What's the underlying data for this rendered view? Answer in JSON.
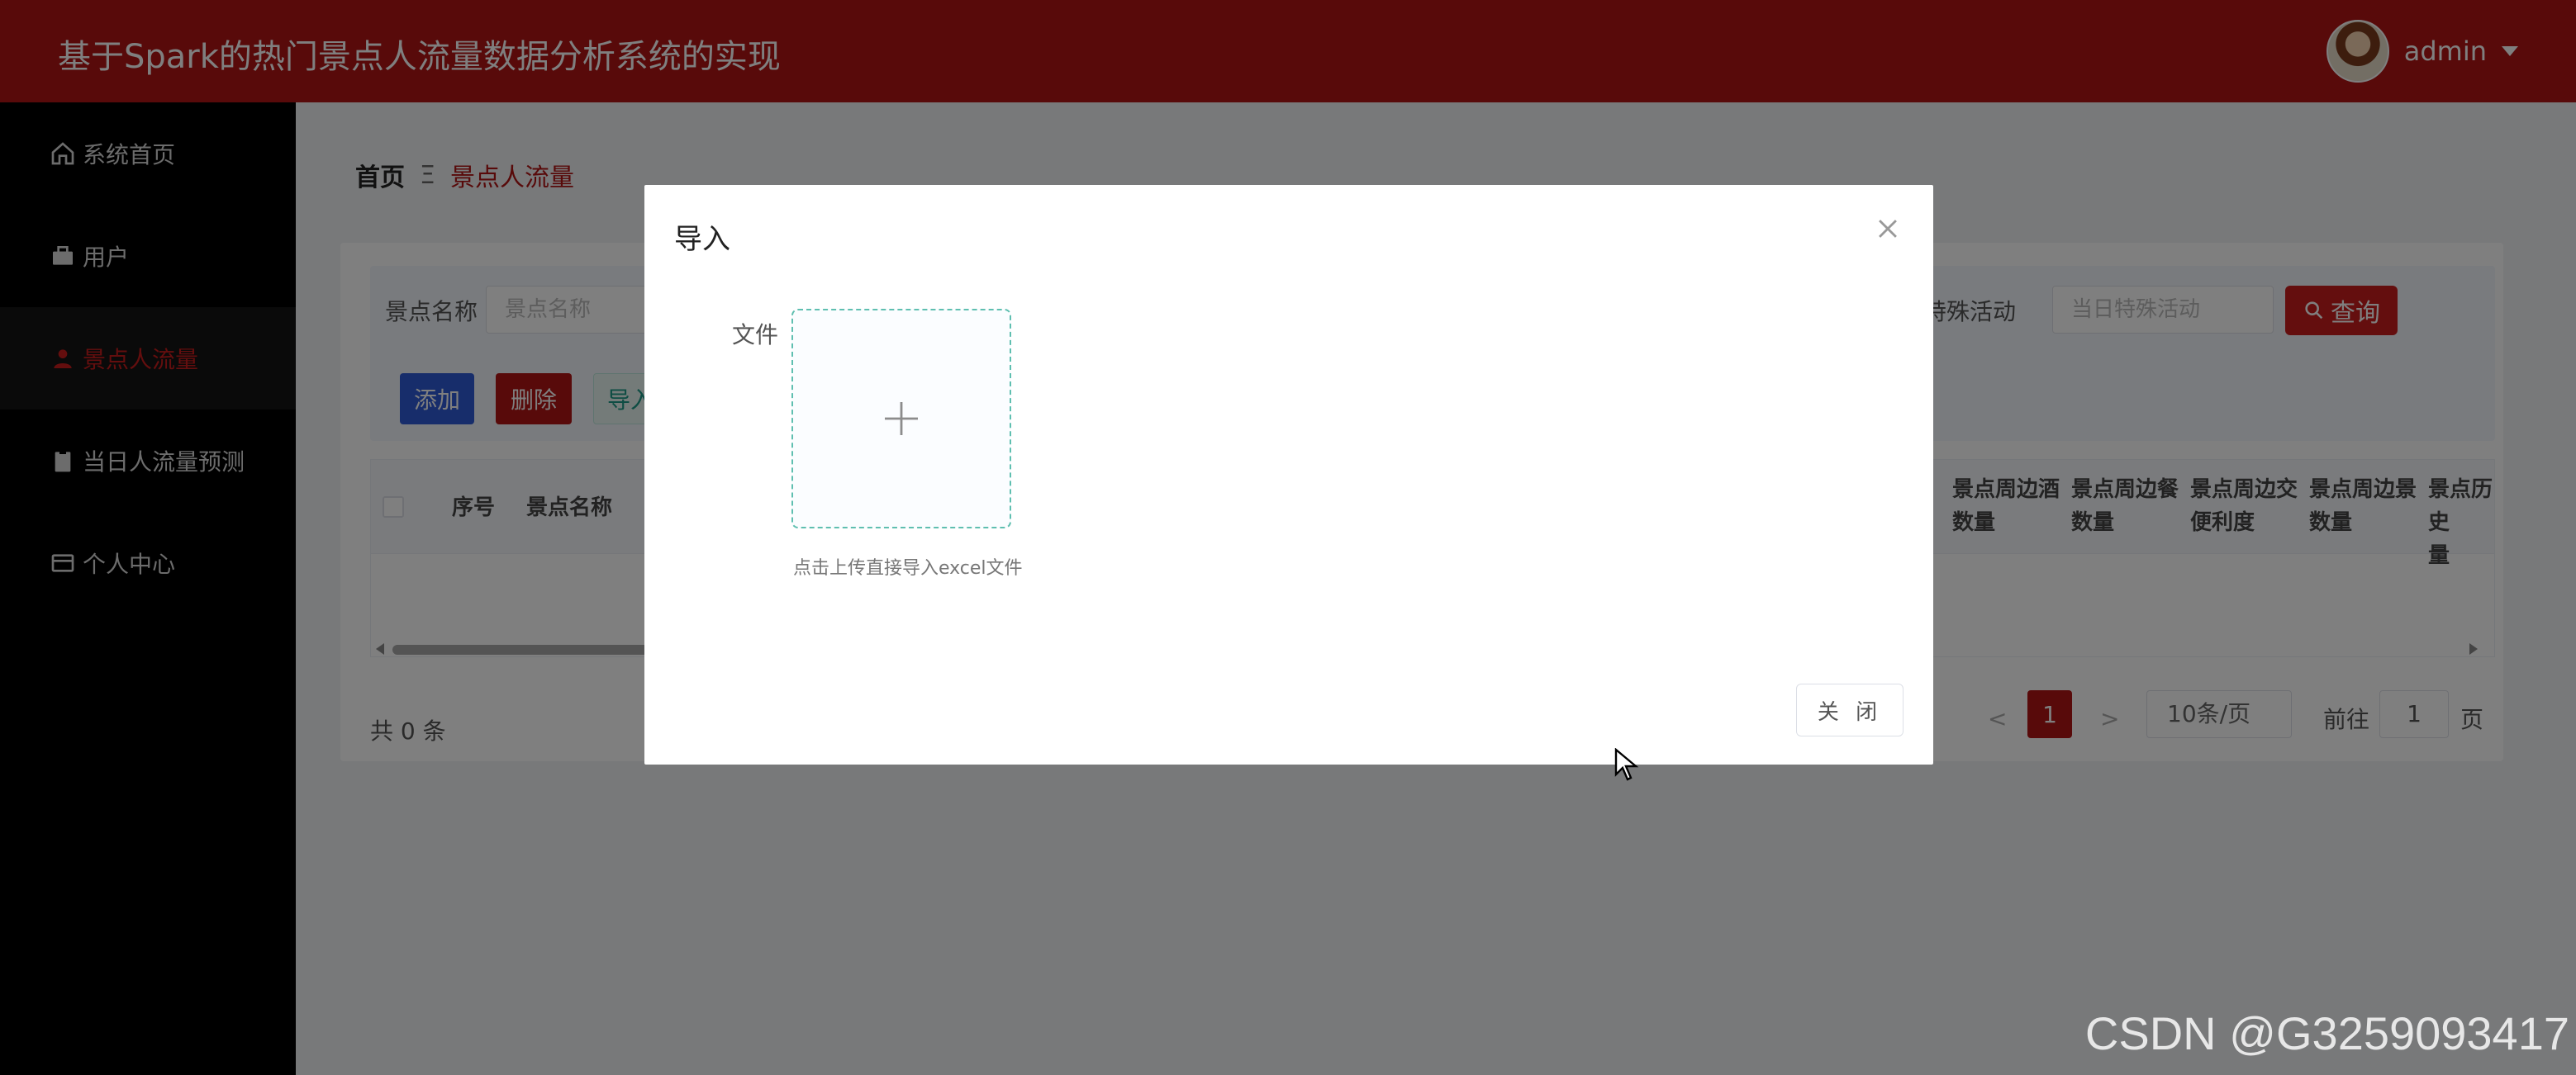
{
  "header": {
    "title": "基于Spark的热门景点人流量数据分析系统的实现",
    "user": "admin"
  },
  "sidebar": {
    "items": [
      {
        "label": "系统首页",
        "icon": "home-icon"
      },
      {
        "label": "用户",
        "icon": "briefcase-icon"
      },
      {
        "label": "景点人流量",
        "icon": "person-icon",
        "active": true
      },
      {
        "label": "当日人流量预测",
        "icon": "clipboard-icon"
      },
      {
        "label": "个人中心",
        "icon": "card-icon"
      }
    ]
  },
  "breadcrumb": {
    "home": "首页",
    "sep": "Ξ",
    "current": "景点人流量"
  },
  "search": {
    "name_label": "景点名称",
    "name_placeholder": "景点名称",
    "activity_label": "特殊活动",
    "activity_placeholder": "当日特殊活动",
    "query_label": "查询"
  },
  "actions": {
    "add": "添加",
    "delete": "删除",
    "import": "导入"
  },
  "table": {
    "columns_left": [
      "序号",
      "景点名称"
    ],
    "columns_right": [
      [
        "景点周边酒",
        "数量"
      ],
      [
        "景点周边餐",
        "数量"
      ],
      [
        "景点周边交",
        "便利度"
      ],
      [
        "景点周边景",
        "数量"
      ],
      [
        "景点历史",
        "量"
      ]
    ]
  },
  "pagination": {
    "total": "共 0 条",
    "prev": "<",
    "current_page": "1",
    "next": ">",
    "page_size": "10条/页",
    "goto_label": "前往",
    "goto_value": "1",
    "page_suffix": "页"
  },
  "dialog": {
    "title": "导入",
    "field_label": "文件",
    "upload_tip": "点击上传直接导入excel文件",
    "close_button": "关 闭"
  },
  "watermark": "CSDN @G3259093417",
  "colors": {
    "brand": "#b01414",
    "sidebar_bg": "#000000",
    "upload_border": "#5fbfb0"
  }
}
